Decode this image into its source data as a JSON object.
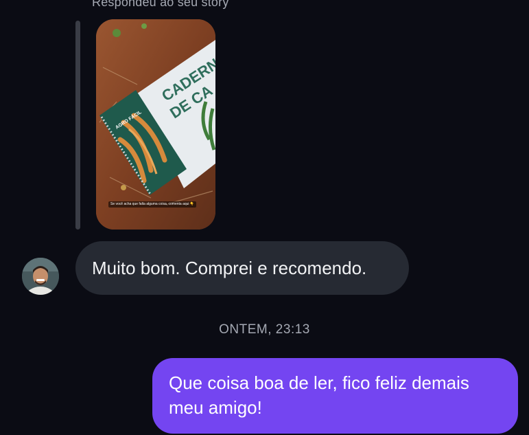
{
  "thread": {
    "story_reply_caption": "Respondeu ao seu story",
    "story": {
      "overlay_text": "Se você acha que falta alguma coisa, comenta aqui 👇",
      "book_brand": "AGRO FÁCIL",
      "book_title_line1": "CADERN",
      "book_title_line2": "DE CA"
    },
    "incoming_message": "Muito bom. Comprei e recomendo.",
    "timestamp": "ONTEM, 23:13",
    "outgoing_message": "Que coisa boa de ler, fico feliz demais meu amigo!"
  },
  "colors": {
    "background": "#0b0c14",
    "incoming_bubble": "#262a33",
    "outgoing_bubble": "#7445f1",
    "secondary_text": "#a5a9b3"
  }
}
